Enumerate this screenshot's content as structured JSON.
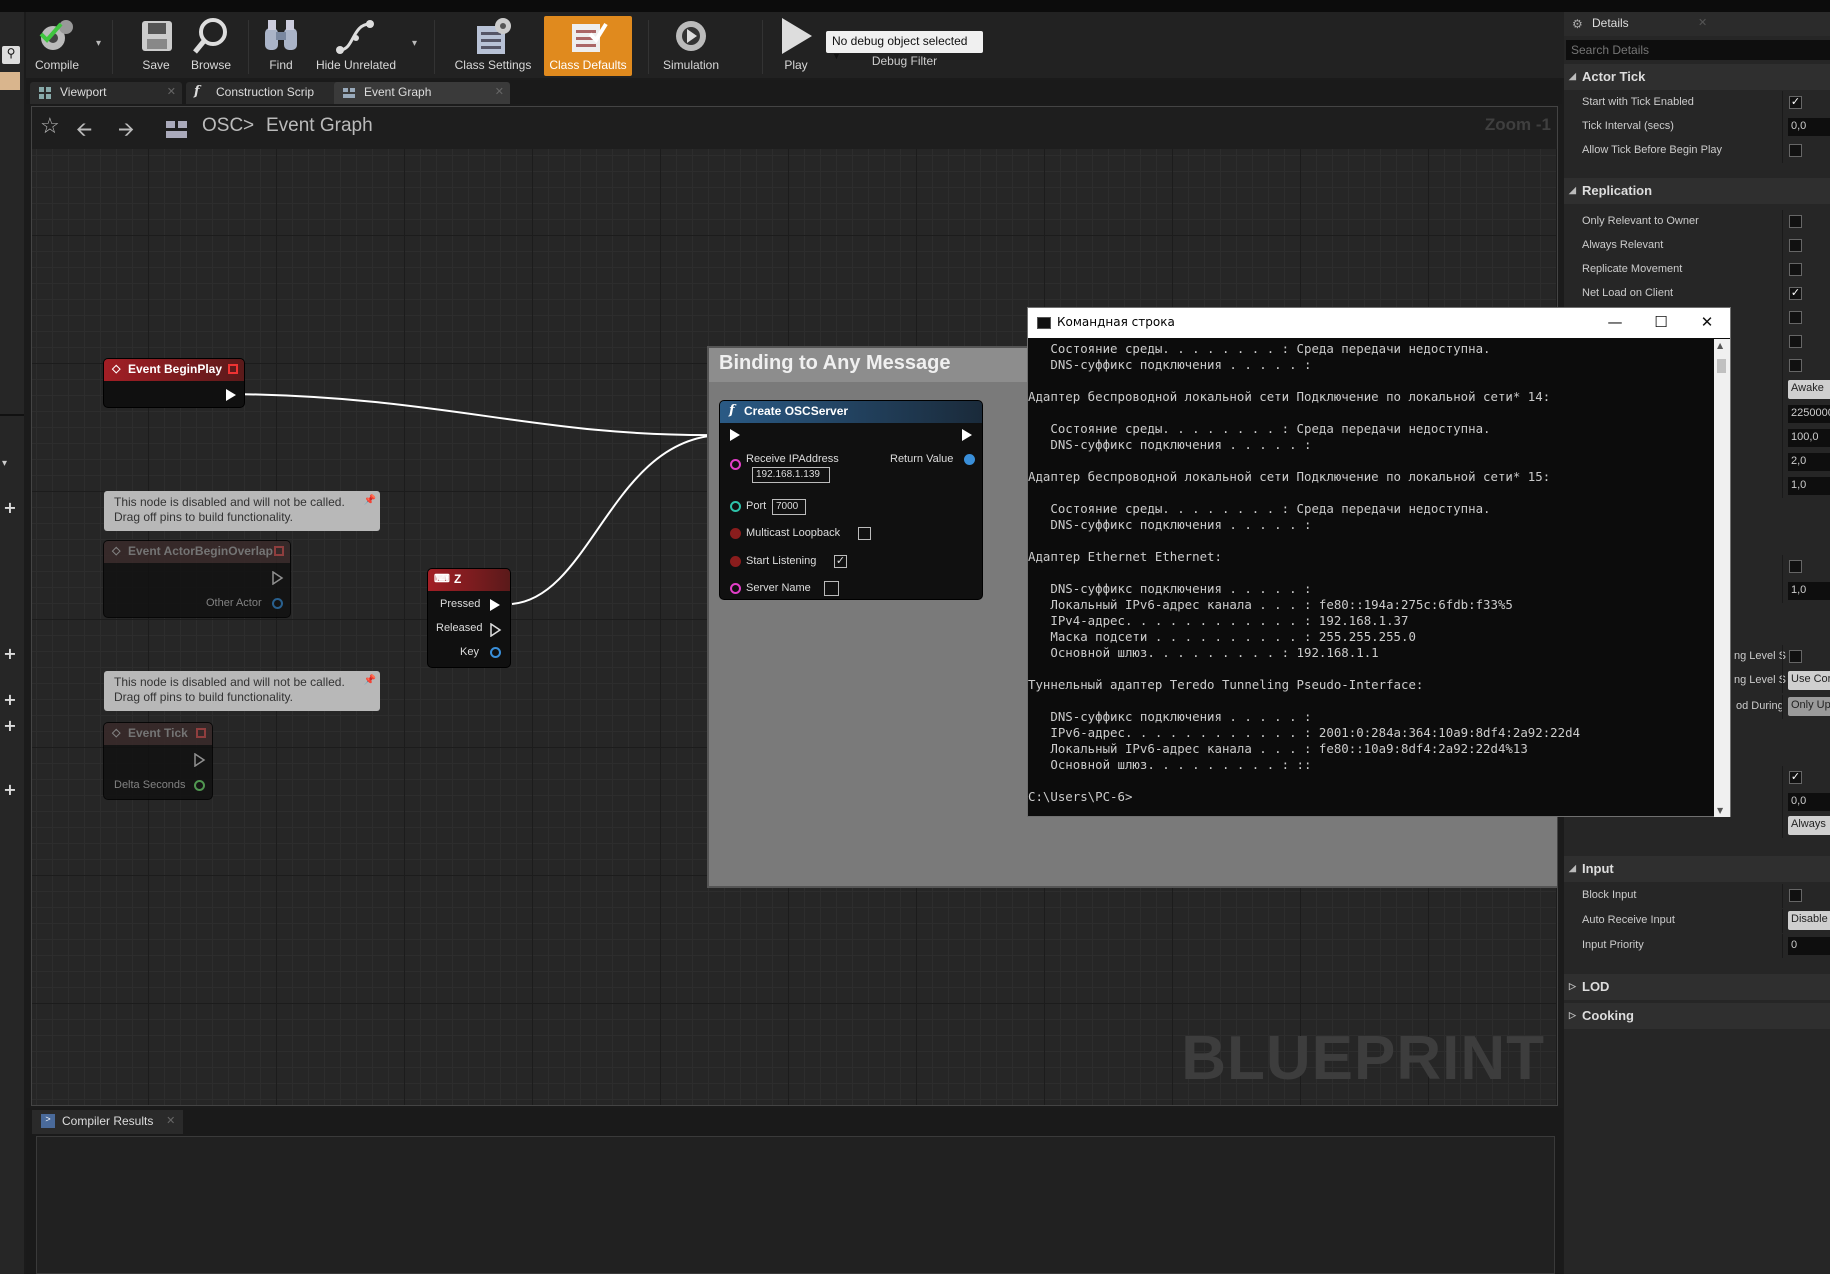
{
  "toolbar": {
    "compile": "Compile",
    "save": "Save",
    "browse": "Browse",
    "find": "Find",
    "hide_unrelated": "Hide Unrelated",
    "class_settings": "Class Settings",
    "class_defaults": "Class Defaults",
    "simulation": "Simulation",
    "play": "Play",
    "debug_select": "No debug object selected",
    "debug_filter": "Debug Filter"
  },
  "tabs": [
    "Viewport",
    "Construction Scrip",
    "Event Graph"
  ],
  "breadcrumb": {
    "root": "OSC",
    "sep": ">",
    "current": "Event Graph"
  },
  "zoom": "Zoom -1",
  "watermark": "BLUEPRINT",
  "group": {
    "title": "Binding to Any Message"
  },
  "nodes": {
    "begin_play": {
      "title": "Event BeginPlay"
    },
    "comment1": {
      "line1": "This node is disabled and will not be called.",
      "line2": "Drag off pins to build functionality."
    },
    "overlap": {
      "title": "Event ActorBeginOverlap",
      "pin": "Other Actor"
    },
    "comment2": {
      "line1": "This node is disabled and will not be called.",
      "line2": "Drag off pins to build functionality."
    },
    "tick": {
      "title": "Event Tick",
      "pin": "Delta Seconds"
    },
    "key_z": {
      "title": "Z",
      "pressed": "Pressed",
      "released": "Released",
      "key": "Key"
    },
    "osc": {
      "title": "Create OSCServer",
      "ip_label": "Receive IPAddress",
      "ip_value": "192.168.1.139",
      "return": "Return Value",
      "port_label": "Port",
      "port_value": "7000",
      "multicast": "Multicast Loopback",
      "multicast_checked": false,
      "start": "Start Listening",
      "start_checked": true,
      "server_name": "Server Name"
    }
  },
  "compiler": {
    "tab": "Compiler Results"
  },
  "details": {
    "title": "Details",
    "search_placeholder": "Search Details",
    "sections": {
      "actor_tick": "Actor Tick",
      "replication": "Replication",
      "input": "Input",
      "lod": "LOD",
      "cooking": "Cooking"
    },
    "actor_tick": [
      {
        "label": "Start with Tick Enabled",
        "checked": true
      },
      {
        "label": "Tick Interval (secs)",
        "value": "0,0"
      },
      {
        "label": "Allow Tick Before Begin Play",
        "checked": false
      }
    ],
    "replication": [
      {
        "label": "Only Relevant to Owner",
        "checked": false
      },
      {
        "label": "Always Relevant",
        "checked": false
      },
      {
        "label": "Replicate Movement",
        "checked": false
      },
      {
        "label": "Net Load on Client",
        "checked": true
      }
    ],
    "hidden_values": [
      "Awake",
      "2250000",
      "100,0",
      "2,0",
      "1,0",
      "1,0"
    ],
    "partial_rows": [
      {
        "label": "ng Level S"
      },
      {
        "label": "ng Level S",
        "value": "Use Cor"
      },
      {
        "label": "od During",
        "value": "Only Up"
      }
    ],
    "misc_values": [
      "0,0",
      "Always"
    ],
    "input": [
      {
        "label": "Block Input",
        "checked": false
      },
      {
        "label": "Auto Receive Input",
        "value": "Disable"
      },
      {
        "label": "Input Priority",
        "value": "0"
      }
    ]
  },
  "cmd": {
    "title": "Командная строка",
    "lines": [
      "   Состояние среды. . . . . . . . : Среда передачи недоступна.",
      "   DNS-суффикс подключения . . . . . :",
      "",
      "Адаптер беспроводной локальной сети Подключение по локальной сети* 14:",
      "",
      "   Состояние среды. . . . . . . . : Среда передачи недоступна.",
      "   DNS-суффикс подключения . . . . . :",
      "",
      "Адаптер беспроводной локальной сети Подключение по локальной сети* 15:",
      "",
      "   Состояние среды. . . . . . . . : Среда передачи недоступна.",
      "   DNS-суффикс подключения . . . . . :",
      "",
      "Адаптер Ethernet Ethernet:",
      "",
      "   DNS-суффикс подключения . . . . . :",
      "   Локальный IPv6-адрес канала . . . : fe80::194a:275c:6fdb:f33%5",
      "   IPv4-адрес. . . . . . . . . . . . : 192.168.1.37",
      "   Маска подсети . . . . . . . . . . : 255.255.255.0",
      "   Основной шлюз. . . . . . . . . : 192.168.1.1",
      "",
      "Туннельный адаптер Teredo Tunneling Pseudo-Interface:",
      "",
      "   DNS-суффикс подключения . . . . . :",
      "   IPv6-адрес. . . . . . . . . . . . : 2001:0:284a:364:10a9:8df4:2a92:22d4",
      "   Локальный IPv6-адрес канала . . . : fe80::10a9:8df4:2a92:22d4%13",
      "   Основной шлюз. . . . . . . . . : ::",
      "",
      "C:\\Users\\PC-6>"
    ]
  }
}
